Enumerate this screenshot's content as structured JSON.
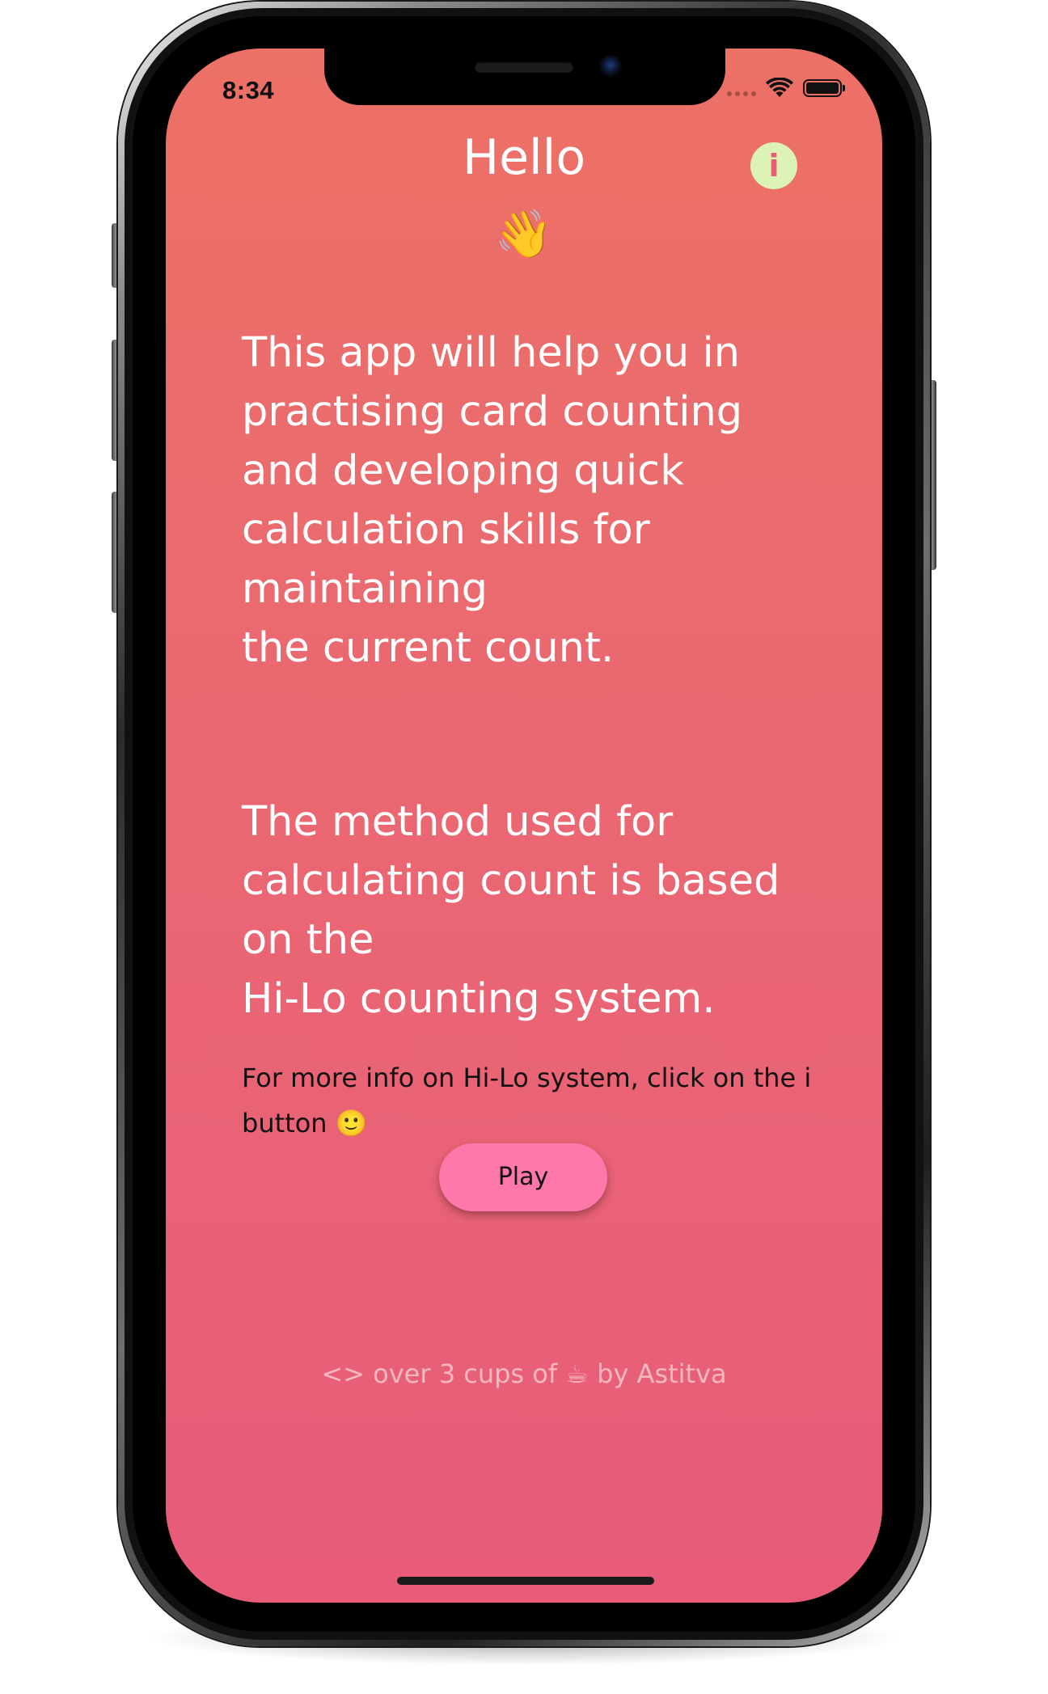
{
  "status_bar": {
    "time": "8:34",
    "wifi_icon": "wifi-icon",
    "battery_icon": "battery-icon"
  },
  "header": {
    "title": "Hello",
    "info_label": "i",
    "wave_emoji": "👋"
  },
  "main": {
    "intro_text": "This app will help you in\npractising card counting\nand developing quick\ncalculation skills for\nmaintaining\nthe current count.",
    "method_text": "The method used for\ncalculating count is based\non the\nHi-Lo counting system.",
    "hint_text": "For more info on Hi-Lo system, click on the i button 🙂",
    "play_label": "Play"
  },
  "footer": {
    "credit": "<> over 3 cups of ☕ by Astitva"
  },
  "colors": {
    "background_top": "#ec7166",
    "background_bottom": "#e85c7a",
    "info_button": "#ddf3b6",
    "play_button": "#ff78ac"
  }
}
